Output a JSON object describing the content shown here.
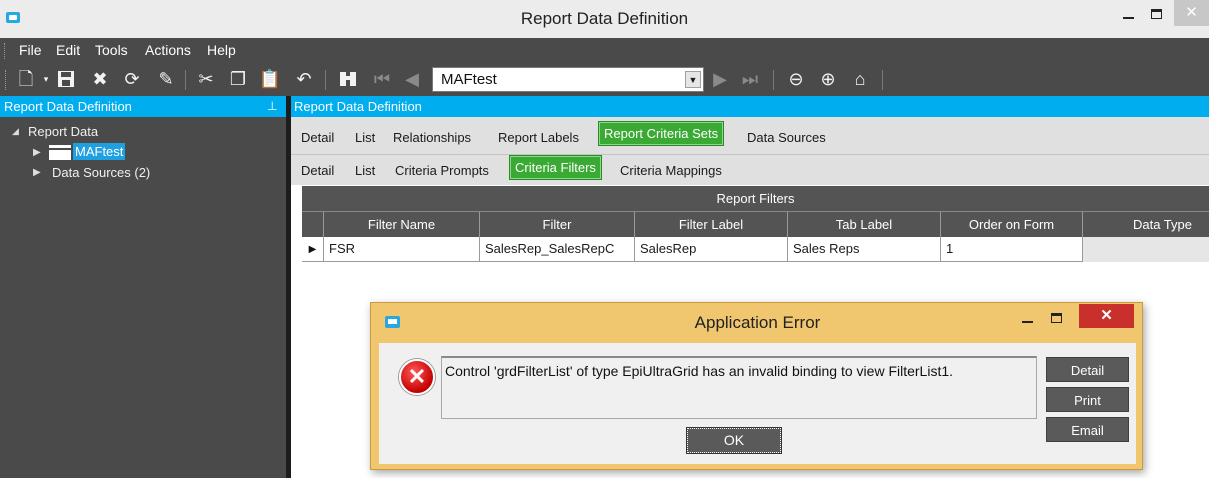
{
  "window": {
    "title": "Report Data Definition",
    "close_glyph": "✕"
  },
  "menu": [
    "File",
    "Edit",
    "Tools",
    "Actions",
    "Help"
  ],
  "toolbar": {
    "icons": [
      "new-icon",
      "save-icon",
      "delete-icon",
      "refresh-icon",
      "clear-icon",
      "cut-icon",
      "copy-icon",
      "paste-icon",
      "undo-icon",
      "search-icon",
      "first-record-icon",
      "previous-record-icon",
      "next-record-icon",
      "last-record-icon",
      "back-icon",
      "forward-icon",
      "home-icon"
    ],
    "record_value": "MAFtest"
  },
  "left_panel": {
    "header": "Report Data Definition",
    "tree": {
      "root": "Report Data",
      "selected": "MAFtest",
      "data_sources": "Data Sources (2)"
    }
  },
  "right_panel": {
    "header": "Report Data Definition",
    "tabs": [
      "Detail",
      "List",
      "Relationships",
      "Report Labels",
      "Report Criteria Sets",
      "Data Sources"
    ],
    "subtabs": [
      "Detail",
      "List",
      "Criteria Prompts",
      "Criteria Filters",
      "Criteria Mappings"
    ],
    "grid": {
      "title": "Report Filters",
      "columns": [
        "Filter Name",
        "Filter",
        "Filter Label",
        "Tab Label",
        "Order on Form",
        "Data Type"
      ],
      "rows": [
        [
          "FSR",
          "SalesRep_SalesRepC",
          "SalesRep",
          "Sales Reps",
          "1",
          ""
        ]
      ]
    }
  },
  "dialog": {
    "title": "Application Error",
    "message": "Control 'grdFilterList' of type EpiUltraGrid has an invalid binding to view FilterList1.",
    "buttons": {
      "detail": "Detail",
      "print": "Print",
      "email": "Email",
      "ok": "OK"
    },
    "close_glyph": "✕"
  },
  "colors": {
    "accent": "#00adef",
    "active_tab": "#3aaa35",
    "dialog_frame": "#f0c66f",
    "error_red": "#c40000",
    "toolbar": "#4a4a4a"
  }
}
